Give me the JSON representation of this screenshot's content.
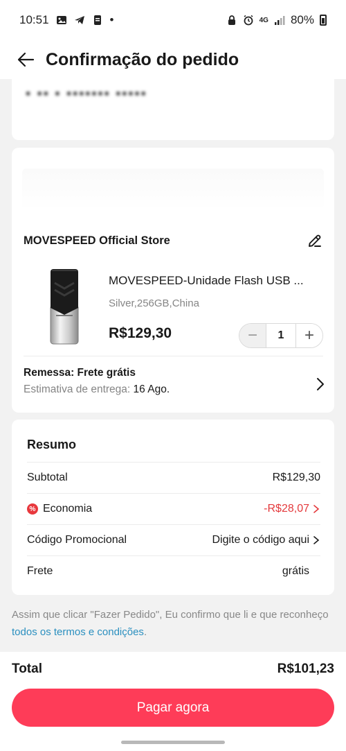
{
  "status_bar": {
    "time": "10:51",
    "dot": "•",
    "network": "4G",
    "battery": "80%"
  },
  "header": {
    "title": "Confirmação do pedido"
  },
  "address": {
    "blurred_text": "▪ ▪▪ ▪ ▪▪▪▪▪▪▪ ▪▪▪▪▪"
  },
  "product_card": {
    "store_name": "MOVESPEED Official Store",
    "product_title": "MOVESPEED-Unidade Flash USB ...",
    "variant": "Silver,256GB,China",
    "price": "R$129,30",
    "quantity": "1",
    "minus_glyph": "−",
    "plus_glyph": "+",
    "shipping_title": "Remessa: Frete grátis",
    "eta_label": "Estimativa de entrega:",
    "eta_date": "16 Ago."
  },
  "summary": {
    "title": "Resumo",
    "subtotal_label": "Subtotal",
    "subtotal_value": "R$129,30",
    "savings_label": "Economia",
    "savings_value": "-R$28,07",
    "promo_label": "Código Promocional",
    "promo_value": "Digite o código aqui",
    "shipping_label": "Frete",
    "shipping_value": "grátis"
  },
  "terms": {
    "text": "Assim que clicar \"Fazer Pedido\", Eu confirmo que li e que reconheço ",
    "link": "todos os termos e condições",
    "end": "."
  },
  "footer": {
    "total_label": "Total",
    "total_value": "R$101,23",
    "pay_label": "Pagar agora"
  },
  "colors": {
    "accent": "#fe3c58",
    "discount": "#e4393c",
    "link": "#2a8fbf"
  },
  "icons": [
    "back-arrow-icon",
    "edit-icon",
    "chevron-right-icon",
    "savings-icon"
  ]
}
